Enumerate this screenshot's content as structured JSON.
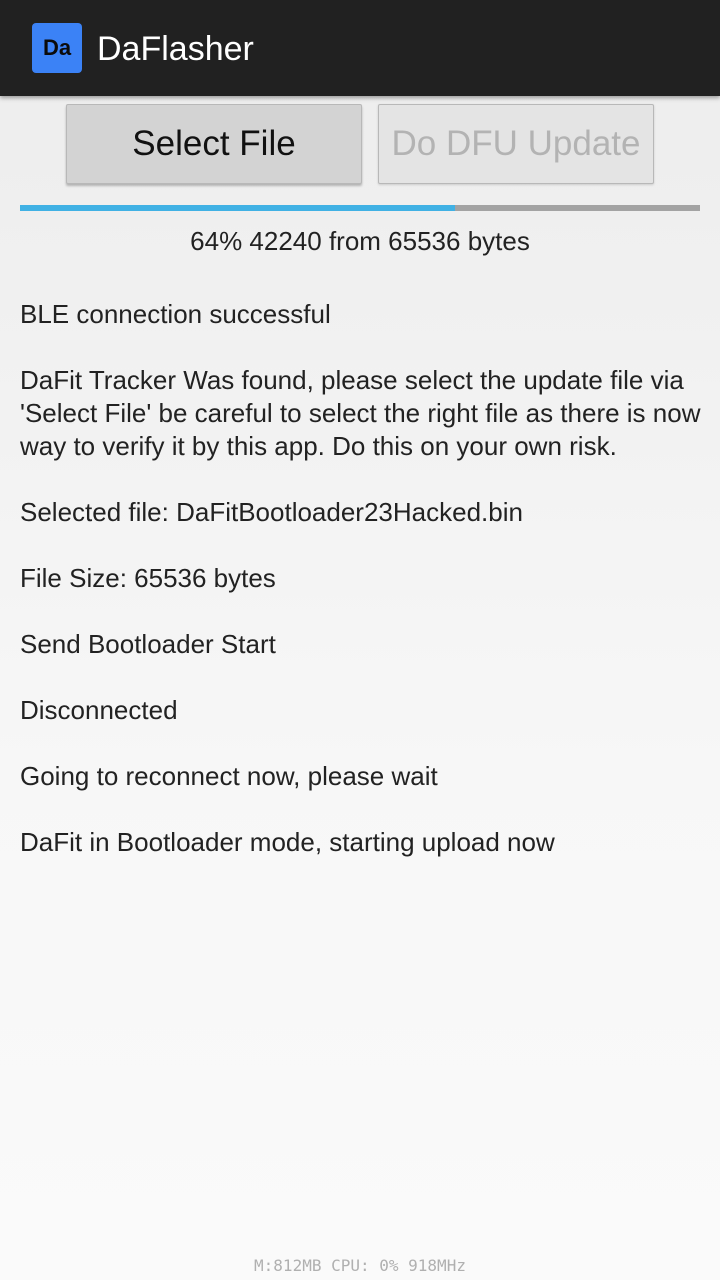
{
  "app": {
    "icon_label": "Da",
    "title": "DaFlasher"
  },
  "buttons": {
    "select_file": "Select File",
    "dfu_update": "Do DFU Update"
  },
  "progress": {
    "fraction": 0.64,
    "text": "64% 42240 from 65536 bytes"
  },
  "log": [
    "BLE connection successful",
    "DaFit Tracker Was found, please select the update file via 'Select File' be careful to select the right file as there is now way to verify it by this app. Do this on your own risk.",
    "Selected file: DaFitBootloader23Hacked.bin",
    "File Size: 65536 bytes",
    "Send Bootloader Start",
    "Disconnected",
    "Going to reconnect now, please wait",
    "DaFit in Bootloader mode, starting upload now"
  ],
  "perf_overlay": "M:812MB CPU: 0%  918MHz",
  "colors": {
    "appbar": "#212121",
    "icon": "#3b82f6",
    "progress": "#40b1e4"
  }
}
